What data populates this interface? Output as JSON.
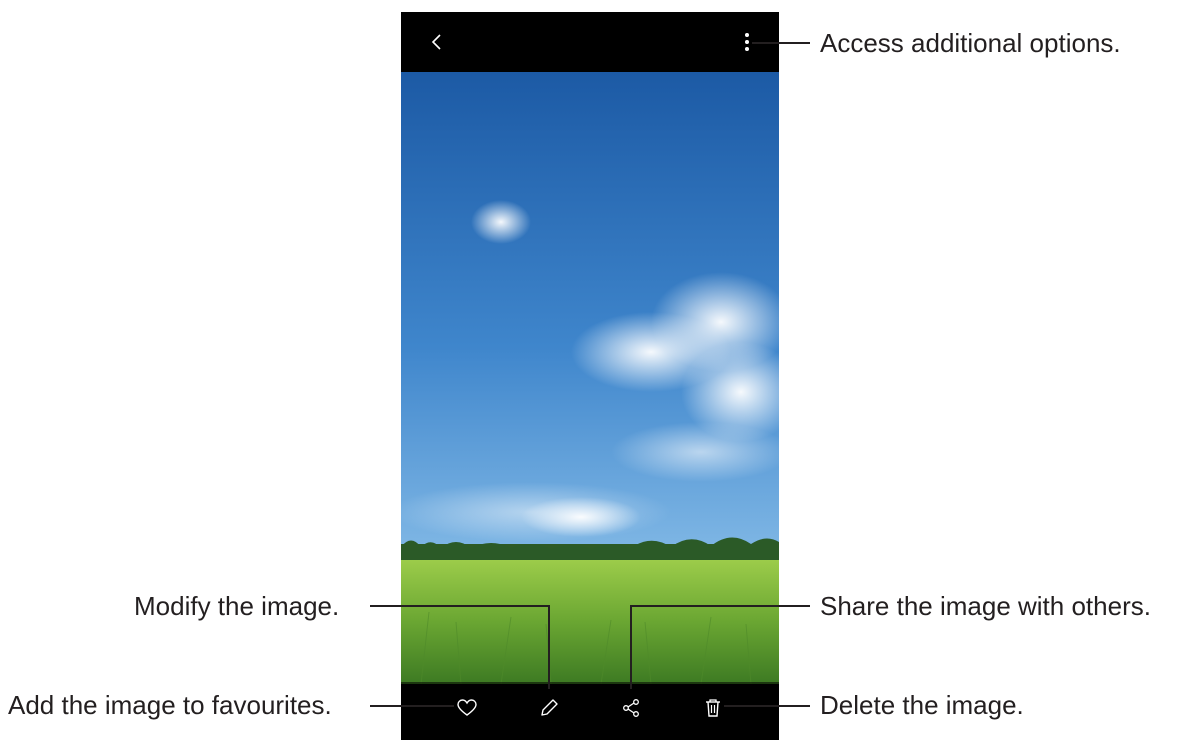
{
  "callouts": {
    "more_options": "Access additional options.",
    "edit": "Modify the image.",
    "share": "Share the image with others.",
    "favourite": "Add the image to favourites.",
    "delete": "Delete the image."
  },
  "icons": {
    "back": "chevron-left-icon",
    "more": "more-vertical-icon",
    "favourite": "heart-icon",
    "edit": "pencil-icon",
    "share": "share-icon",
    "delete": "trash-icon"
  },
  "colors": {
    "callout_text": "#231f20",
    "sky_top": "#1f5fa8",
    "sky_bottom": "#9cc8ec",
    "grass": "#7cb342"
  }
}
